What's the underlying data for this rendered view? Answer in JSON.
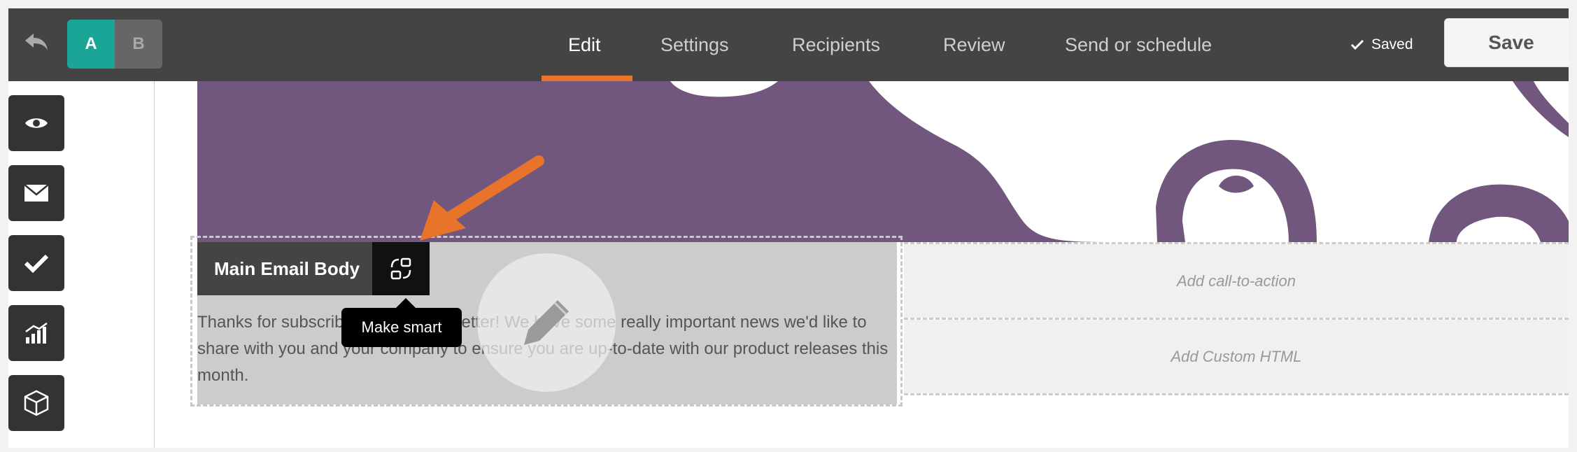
{
  "topbar": {
    "ab_a": "A",
    "ab_b": "B",
    "tabs": [
      {
        "label": "Edit"
      },
      {
        "label": "Settings"
      },
      {
        "label": "Recipients"
      },
      {
        "label": "Review"
      },
      {
        "label": "Send or schedule"
      }
    ],
    "active_tab": "Edit",
    "saved_label": "Saved",
    "save_label": "Save"
  },
  "tools": [
    {
      "icon": "eye-icon"
    },
    {
      "icon": "envelope-icon"
    },
    {
      "icon": "checkmark-icon"
    },
    {
      "icon": "chart-icon"
    },
    {
      "icon": "box-icon"
    }
  ],
  "module": {
    "label": "Main Email Body",
    "smart_icon": "make-smart-icon",
    "tooltip": "Make smart",
    "body_text": "Thanks for subscribing to our newsletter! We have some really important news we'd like to share with you and your company to ensure you are up-to-date with our product releases this month."
  },
  "right_modules": {
    "cta_placeholder": "Add call-to-action",
    "html_placeholder": "Add Custom HTML"
  },
  "colors": {
    "topbar": "#444444",
    "accent_teal": "#1aa596",
    "accent_orange": "#e8732b",
    "hero_purple": "#71577e"
  }
}
